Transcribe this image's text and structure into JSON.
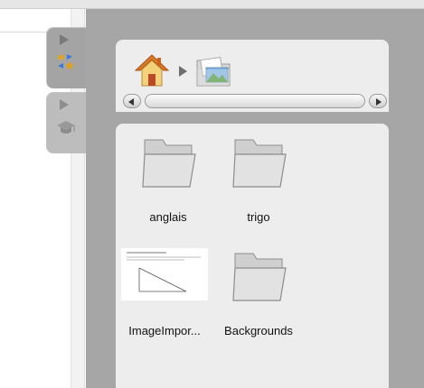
{
  "left_tabs": [
    {
      "icon": "layout-icon"
    },
    {
      "icon": "graduation-cap-icon"
    }
  ],
  "breadcrumb": {
    "items": [
      {
        "icon": "home-icon"
      },
      {
        "icon": "pictures-folder-icon"
      }
    ]
  },
  "files": [
    {
      "label": "anglais",
      "type": "folder"
    },
    {
      "label": "trigo",
      "type": "folder"
    },
    {
      "label": "ImageImpor...",
      "type": "image"
    },
    {
      "label": "Backgrounds",
      "type": "folder"
    }
  ],
  "colors": {
    "panel_bg": "#ededed",
    "dark_bg": "#a6a6a6",
    "home_roof": "#e07a22",
    "home_body": "#f5d27a"
  }
}
